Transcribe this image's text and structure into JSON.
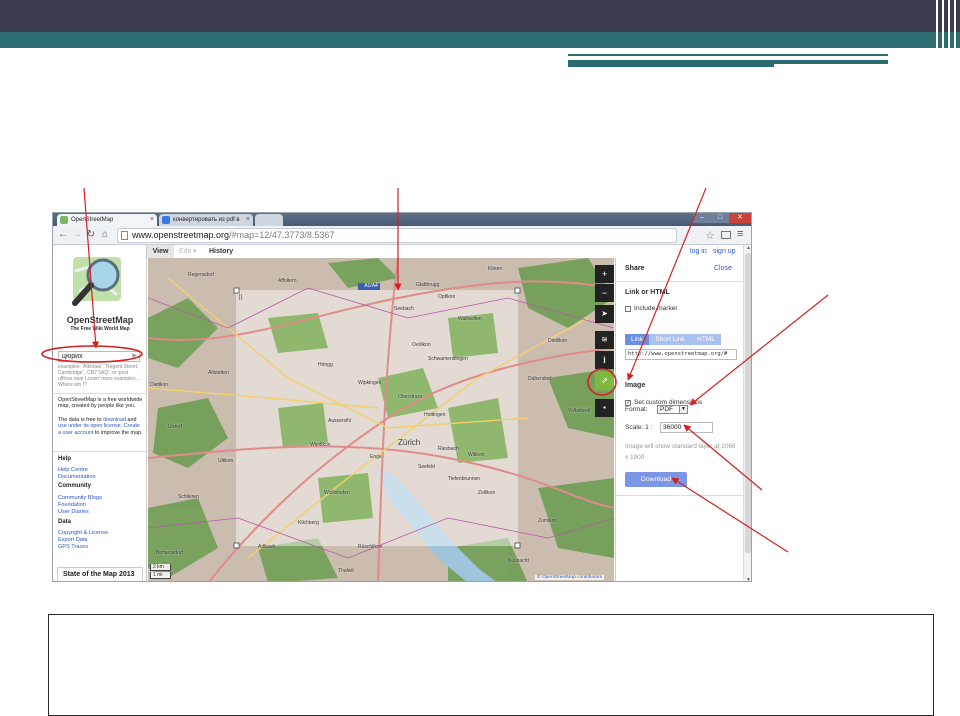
{
  "browser": {
    "tabs": [
      {
        "label": "OpenStreetMap",
        "icon": "osm-favicon"
      },
      {
        "label": "конвертировать из pdf в",
        "icon": "google-favicon"
      },
      {
        "label": "",
        "icon": "new-tab"
      }
    ],
    "url_host": "www.openstreetmap.org",
    "url_path": "/#map=12/47.3773/8.5367"
  },
  "osm_menu": {
    "view": "View",
    "edit": "Edit",
    "history": "History",
    "login": "log in",
    "signup": "sign up"
  },
  "sidebar": {
    "brand": "OpenStreetMap",
    "tagline": "The Free Wiki World Map",
    "search_value": "цюрих",
    "examples": "examples: 'Alkmaar', 'Regent Street, Cambridge', 'CB2 5AQ', or 'post offices near Lünen' more examples... Where am I?",
    "intro_1": "OpenStreetMap is a free worldwide map, created by people like you.",
    "intro_2_pre": "The data is free to ",
    "intro_2_link1": "download",
    "intro_2_mid": " and ",
    "intro_2_link2": "use under its open license",
    "intro_2_post": ". ",
    "intro_2_link3": "Create a user account",
    "intro_2_end": " to improve the map.",
    "help_title": "Help",
    "help_links": [
      "Help Centre",
      "Documentation"
    ],
    "community_title": "Community",
    "community_links": [
      "Community Blogs",
      "Foundation",
      "User Diaries"
    ],
    "data_title": "Data",
    "data_links": [
      "Copyright & License",
      "Export Data",
      "GPS Traces"
    ],
    "sotm": "State of the Map 2013"
  },
  "map": {
    "places": [
      "Regensdorf",
      "Glattbrugg",
      "Opfikon",
      "Wallisellen",
      "Seebach",
      "Oerlikon",
      "Schwamendingen",
      "Höngg",
      "Wipkingen",
      "Dübendorf",
      "Altstetten",
      "Oberstrass",
      "Hottingen",
      "Aussersihl",
      "Wiedikon",
      "Zürich",
      "Riesbach",
      "Enge",
      "Witikon",
      "Seefeld",
      "Tiefenbrunnen",
      "Wollishofen",
      "Kilchberg",
      "Zollikon",
      "Adliswil",
      "Rüschlikon",
      "Thalwil",
      "Uitikon",
      "Schlieren",
      "Dietikon",
      "Urdorf",
      "Birmensdorf",
      "Kloten",
      "Dietlikon",
      "Volketswil",
      "Zumikon",
      "Küsnacht",
      "Affoltern"
    ],
    "road_shield": "A1/A4",
    "scale_km": "2 km",
    "scale_mi": "1 mi",
    "attribution_prefix": "© ",
    "attribution": "OpenStreetMap contributors",
    "controls": [
      "zoom-in",
      "zoom-out",
      "locate",
      "layers",
      "info",
      "share",
      "note"
    ]
  },
  "share": {
    "title": "Share",
    "close": "Close",
    "link_title": "Link or HTML",
    "include_marker": "Include marker",
    "tabs": [
      "Link",
      "Short Link",
      "HTML"
    ],
    "link_value": "http://www.openstreetmap.org/#",
    "image_title": "Image",
    "custom_dimensions": "Set custom dimensions",
    "custom_dimensions_checked": true,
    "format_label": "Format:",
    "format_value": "PDF",
    "scale_label": "Scale:  1 :",
    "scale_value": "36000",
    "note": "Image will show standard layer at 2066 x 1900",
    "download": "Download"
  },
  "colors": {
    "slide_top": "#3b3d4c",
    "slide_teal": "#2c6b6f",
    "annotation_red": "#d42020",
    "osm_blue": "#2a56c6",
    "download_button": "#7b96e3"
  }
}
